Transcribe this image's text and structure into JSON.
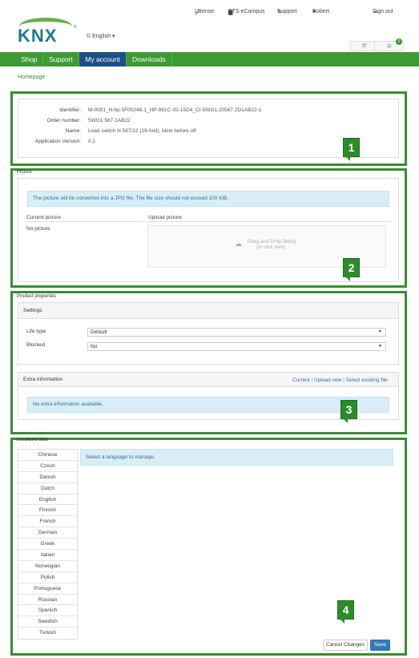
{
  "header": {
    "logo_text": "KNX",
    "logo_reg": "®",
    "language": "English",
    "links": {
      "license": "License",
      "ets_ecampus": "ETS eCampus",
      "support": "Support",
      "user": "Robert",
      "signout": "Sign out"
    },
    "cart_badge": "0"
  },
  "nav": [
    "Shop",
    "Support",
    "My account",
    "Downloads"
  ],
  "breadcrumb": "Homepage",
  "product": {
    "identifier_label": "Identifier:",
    "identifier": "M-0001_H-hp.5F00248-1_HP-981C-02-15D4_CI-5WG1.20567.2D1AB22-1",
    "order_label": "Order number:",
    "order": "5WG1 567-1AB22",
    "name_label": "Name:",
    "name": "Load switch N 567/22 (16-fold), blink before off",
    "appversion_label": "Application Version:",
    "appversion": "0.2"
  },
  "picture": {
    "section_title": "Picture",
    "info": "The picture will be converted into a JPG file. The file size should not exceed 100 KiB.",
    "current_label": "Current picture",
    "upload_label": "Upload picture",
    "no_picture": "No picture",
    "drop_text": "Drag and Drop file(s)",
    "drop_sub": "(or click here)"
  },
  "properties": {
    "section_title": "Product properties",
    "settings_title": "Settings",
    "life_type_label": "Life type",
    "life_type_value": "Default",
    "blocked_label": "Blocked",
    "blocked_value": "No",
    "extra_title": "Extra information",
    "extra_links": {
      "current": "Current",
      "upload_new": "Upload new",
      "select_existing": "Select existing file"
    },
    "extra_info": "No extra information available."
  },
  "localized": {
    "section_title": "Localized data",
    "info": "Select a language to manage.",
    "languages": [
      "Chinese",
      "Czech",
      "Danish",
      "Dutch",
      "English",
      "Finnish",
      "French",
      "German",
      "Greek",
      "Italian",
      "Norwegian",
      "Polish",
      "Portuguese",
      "Russian",
      "Spanish",
      "Swedish",
      "Turkish"
    ]
  },
  "buttons": {
    "cancel": "Cancel Changes",
    "save": "Save"
  },
  "callouts": [
    "1",
    "2",
    "3",
    "4"
  ],
  "colors": {
    "nav_green": "#3e9a34",
    "nav_active": "#1d4f86",
    "annotation_green": "#3a8c33",
    "info_blue": "#d9edf7",
    "primary": "#337ab7"
  },
  "icons": [
    "key-icon",
    "graduation-cap-icon",
    "wrench-icon",
    "user-icon",
    "sign-out-icon",
    "cart-icon",
    "globe-icon",
    "upload-cloud-icon"
  ]
}
